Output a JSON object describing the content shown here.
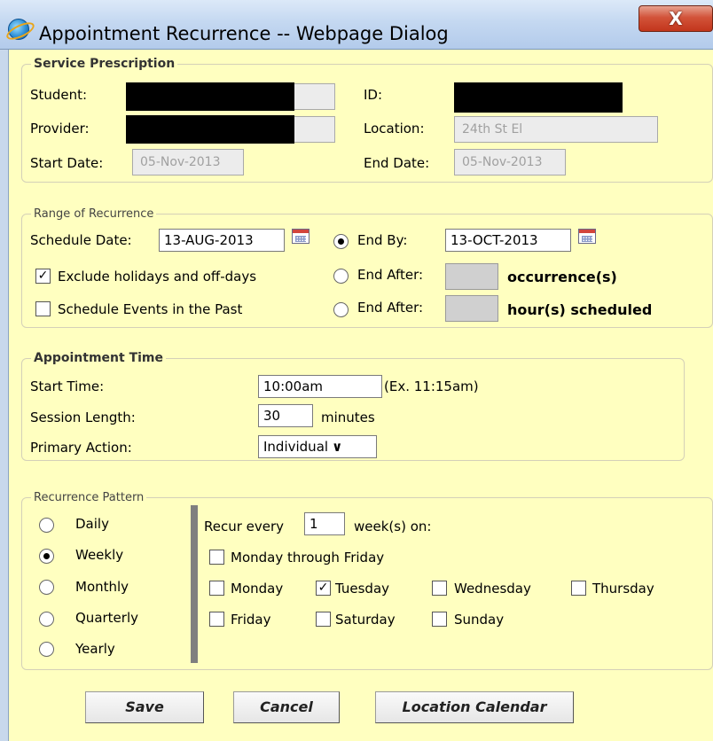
{
  "window": {
    "title": "Appointment Recurrence -- Webpage Dialog",
    "close_glyph": "X"
  },
  "service_prescription": {
    "legend": "Service Prescription",
    "student_label": "Student:",
    "id_label": "ID:",
    "provider_label": "Provider:",
    "location_label": "Location:",
    "location_value": "24th St El",
    "start_date_label": "Start Date:",
    "start_date_value": "05-Nov-2013",
    "end_date_label": "End Date:",
    "end_date_value": "05-Nov-2013"
  },
  "range": {
    "legend": "Range of Recurrence",
    "schedule_date_label": "Schedule Date:",
    "schedule_date_value": "13-AUG-2013",
    "end_by_label": "End By:",
    "end_by_value": "13-OCT-2013",
    "end_by_selected": true,
    "exclude_holidays_label": "Exclude holidays and off-days",
    "exclude_holidays_checked": true,
    "end_after_label": "End After:",
    "occurrences_label": "occurrence(s)",
    "end_after2_label": "End After:",
    "hours_label": "hour(s) scheduled",
    "past_events_label": "Schedule Events in the Past",
    "past_events_checked": false
  },
  "appointment_time": {
    "legend": "Appointment Time",
    "start_time_label": "Start Time:",
    "start_time_value": "10:00am",
    "start_time_hint": "(Ex. 11:15am)",
    "session_length_label": "Session Length:",
    "session_length_value": "30",
    "minutes_label": "minutes",
    "primary_action_label": "Primary Action:",
    "primary_action_value": "Individual",
    "dropdown_glyph": "∨"
  },
  "pattern": {
    "legend": "Recurrence Pattern",
    "options": [
      {
        "label": "Daily",
        "selected": false
      },
      {
        "label": "Weekly",
        "selected": true
      },
      {
        "label": "Monthly",
        "selected": false
      },
      {
        "label": "Quarterly",
        "selected": false
      },
      {
        "label": "Yearly",
        "selected": false
      }
    ],
    "recur_every_label": "Recur every",
    "recur_every_value": "1",
    "weeks_on_label": "week(s) on:",
    "mon_fri_label": "Monday through Friday",
    "days": [
      {
        "label": "Monday",
        "checked": false
      },
      {
        "label": "Tuesday",
        "checked": true
      },
      {
        "label": "Wednesday",
        "checked": false
      },
      {
        "label": "Thursday",
        "checked": false
      },
      {
        "label": "Friday",
        "checked": false
      },
      {
        "label": "Saturday",
        "checked": false
      },
      {
        "label": "Sunday",
        "checked": false
      }
    ]
  },
  "buttons": {
    "save": "Save",
    "cancel": "Cancel",
    "location_calendar": "Location Calendar"
  },
  "check_glyph": "✓"
}
